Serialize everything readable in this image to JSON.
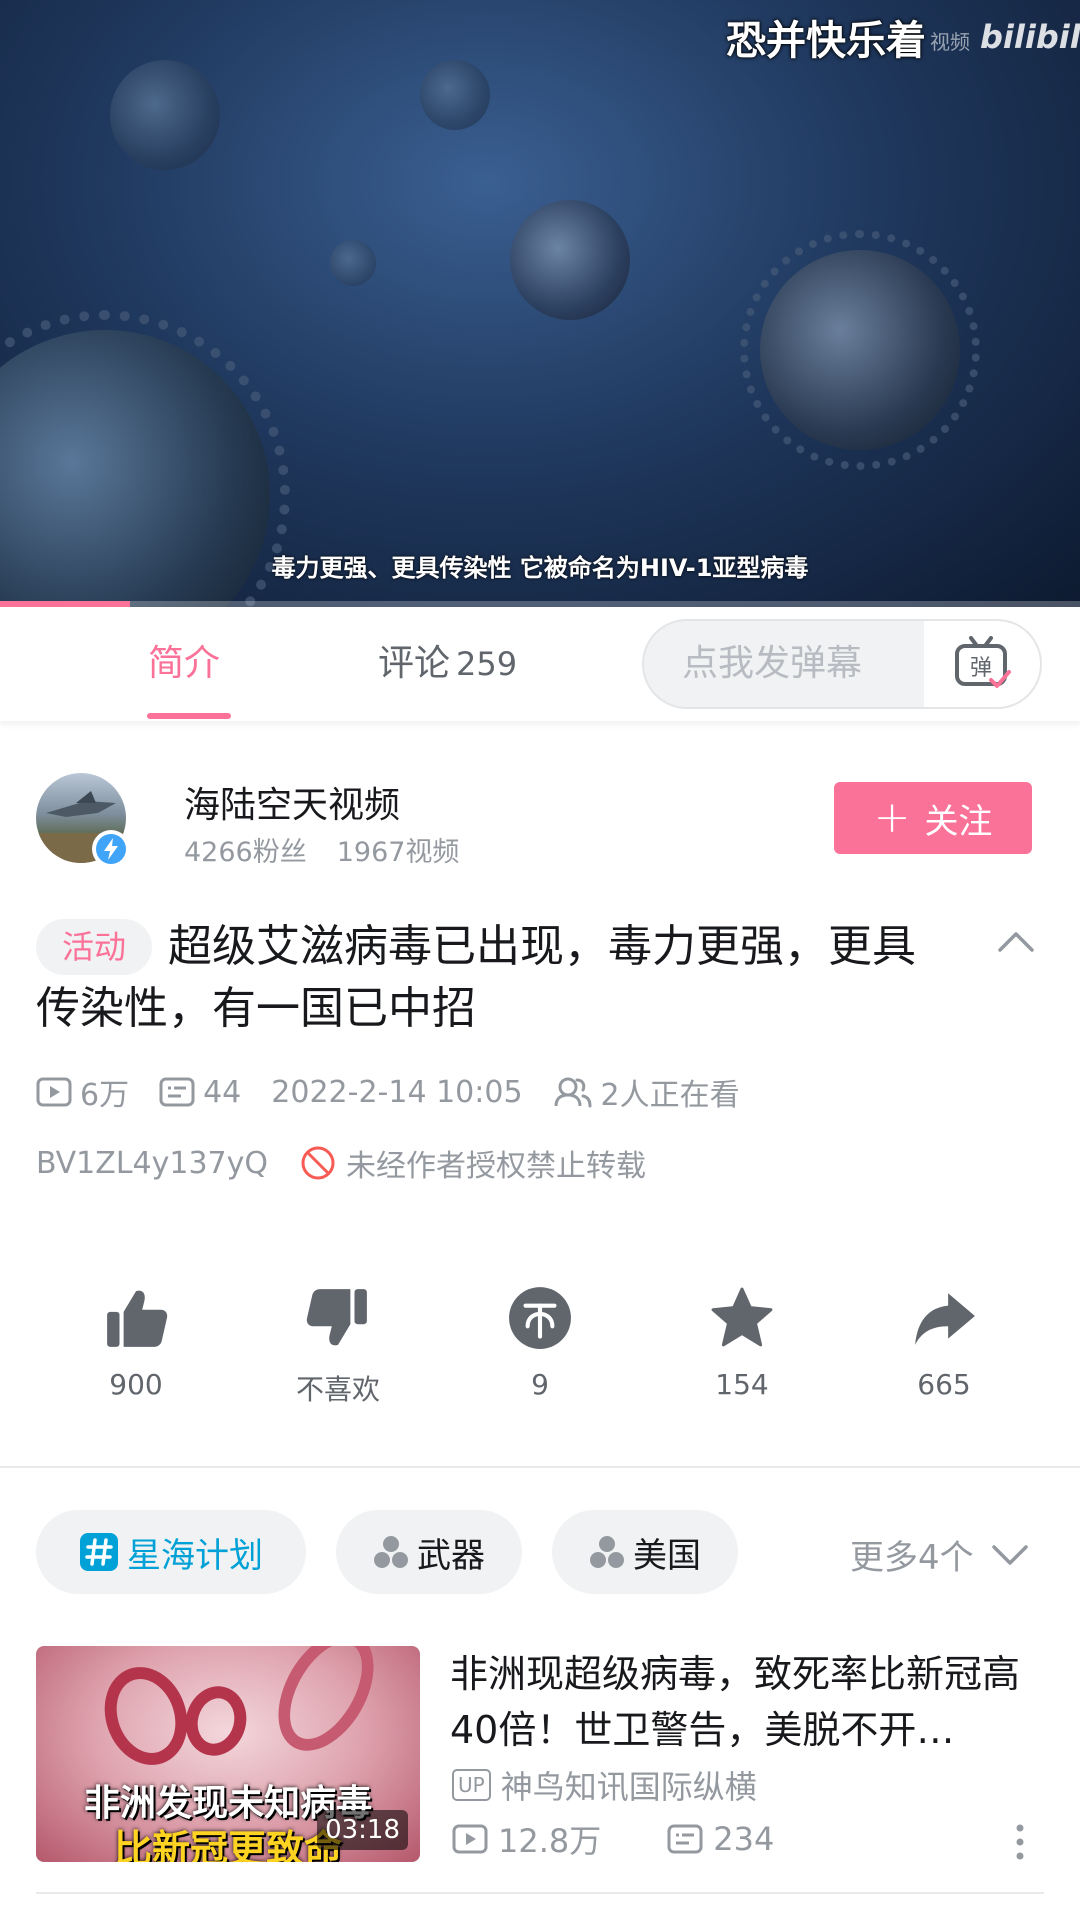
{
  "player": {
    "overlay_title": "恐并快乐着",
    "watermark_sub": "视频",
    "watermark_logo": "bilibili",
    "subtitle": "毒力更强、更具传染性 它被命名为HIV-1亚型病毒",
    "progress": 0.12
  },
  "tabs": {
    "intro": "简介",
    "comments": "评论",
    "comments_count": "259"
  },
  "danmaku": {
    "placeholder": "点我发弹幕",
    "button_glyph": "弹"
  },
  "uploader": {
    "name": "海陆空天视频",
    "fans": "4266粉丝",
    "videos": "1967视频",
    "follow_label": "关注"
  },
  "video": {
    "tag": "活动",
    "title": "超级艾滋病毒已出现，毒力更强，更具传染性，有一国已中招",
    "plays": "6万",
    "danmaku_count": "44",
    "date": "2022-2-14 10:05",
    "watching": "2人正在看",
    "bvid": "BV1ZL4y137yQ",
    "copyright_notice": "未经作者授权禁止转载"
  },
  "actions": {
    "like": "900",
    "dislike": "不喜欢",
    "coin": "9",
    "favorite": "154",
    "share": "665"
  },
  "tags": {
    "items": [
      "星海计划",
      "武器",
      "美国"
    ],
    "more": "更多4个"
  },
  "recommend": {
    "title": "非洲现超级病毒，致死率比新冠高40倍！世卫警告，美脱不开…",
    "up_badge": "UP",
    "uploader": "神鸟知讯国际纵横",
    "plays": "12.8万",
    "danmaku": "234",
    "duration": "03:18",
    "thumb_caption1": "非洲发现未知病毒",
    "thumb_caption2": "比新冠更致命"
  },
  "colors": {
    "accent": "#fb7299",
    "link_blue": "#00a1d6",
    "muted": "#9499a0"
  }
}
